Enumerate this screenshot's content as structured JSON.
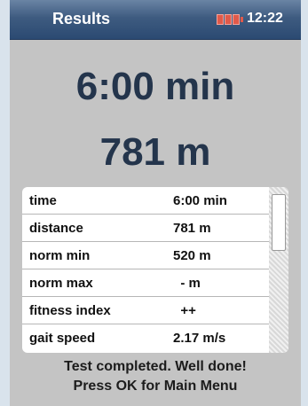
{
  "header": {
    "title": "Results",
    "clock": "12:22",
    "battery_icon": "battery-low-icon",
    "battery_color": "#e15a4a"
  },
  "summary": {
    "time": "6:00 min",
    "distance": "781 m"
  },
  "table": {
    "rows": [
      {
        "label": "time",
        "value": "6:00 min"
      },
      {
        "label": "distance",
        "value": "781 m"
      },
      {
        "label": "norm min",
        "value": "520 m"
      },
      {
        "label": "norm max",
        "value": "  - m"
      },
      {
        "label": "fitness index",
        "value": "  ++"
      },
      {
        "label": "gait speed",
        "value": "2.17 m/s"
      }
    ]
  },
  "footer": {
    "line1": "Test completed. Well done!",
    "line2": "Press OK for Main Menu"
  },
  "colors": {
    "header_bg": "#3e5b80",
    "big_text": "#24354c",
    "screen_bg": "#c4c4c4"
  }
}
